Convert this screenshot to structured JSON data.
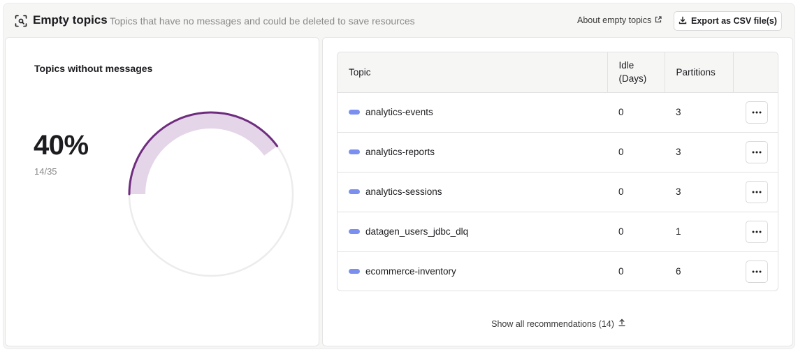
{
  "header": {
    "title": "Empty topics",
    "subtitle": "Topics that have no messages and could be deleted to save resources",
    "about_link": "About empty topics",
    "export_label": "Export as CSV file(s)",
    "title_icon": "scan-box-icon",
    "about_icon": "external-link-icon",
    "export_icon": "download-icon"
  },
  "summary": {
    "card_title": "Topics without messages",
    "percent_label": "40%",
    "ratio_label": "14/35",
    "fraction": 0.4,
    "gauge_fill_color": "#e4d6e8",
    "gauge_stroke_color": "#6f2c7f",
    "gauge_track_color": "#ececec"
  },
  "table": {
    "columns": [
      "Topic",
      "Idle (Days)",
      "Partitions",
      ""
    ],
    "rows": [
      {
        "topic": "analytics-events",
        "idle": "0",
        "partitions": "3"
      },
      {
        "topic": "analytics-reports",
        "idle": "0",
        "partitions": "3"
      },
      {
        "topic": "analytics-sessions",
        "idle": "0",
        "partitions": "3"
      },
      {
        "topic": "datagen_users_jdbc_dlq",
        "idle": "0",
        "partitions": "1"
      },
      {
        "topic": "ecommerce-inventory",
        "idle": "0",
        "partitions": "6"
      }
    ],
    "topic_dot_color": "#7b8ff0",
    "row_action_icon": "more-horizontal-icon"
  },
  "footer": {
    "show_all_label": "Show all recommendations (14)",
    "show_all_icon": "arrow-up-icon"
  }
}
